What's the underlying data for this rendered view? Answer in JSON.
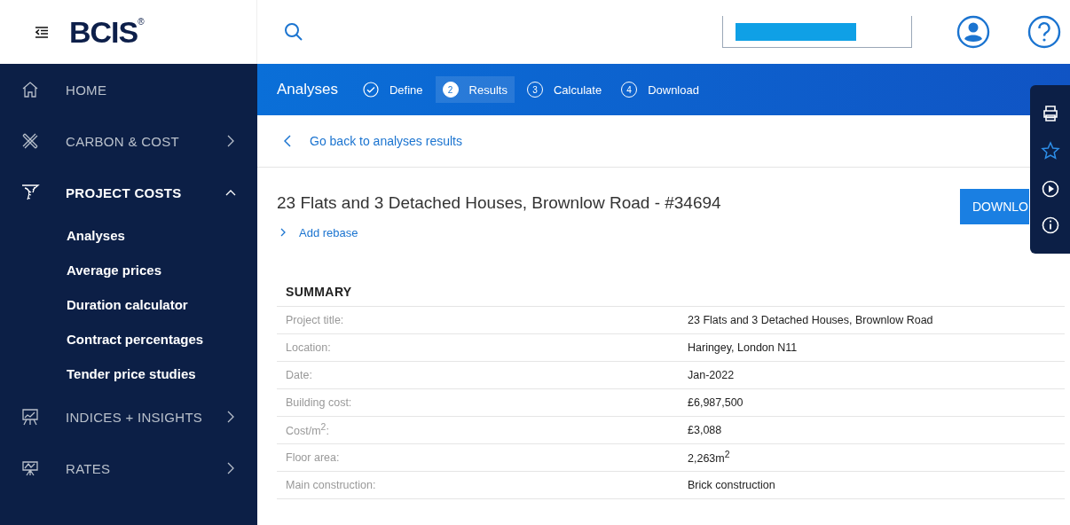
{
  "brand": {
    "logo": "BCIS",
    "mark": "®"
  },
  "header": {
    "search_field": {
      "filled": true
    }
  },
  "sidebar": {
    "items": [
      {
        "label": "HOME",
        "kind": "link",
        "expanded": false
      },
      {
        "label": "CARBON & COST",
        "kind": "group",
        "expanded": false
      },
      {
        "label": "PROJECT COSTS",
        "kind": "group",
        "expanded": true,
        "children": [
          {
            "label": "Analyses"
          },
          {
            "label": "Average prices"
          },
          {
            "label": "Duration calculator"
          },
          {
            "label": "Contract percentages"
          },
          {
            "label": "Tender price studies"
          }
        ]
      },
      {
        "label": "INDICES + INSIGHTS",
        "kind": "group",
        "expanded": false
      },
      {
        "label": "RATES",
        "kind": "group",
        "expanded": false
      }
    ]
  },
  "stepbar": {
    "title": "Analyses",
    "steps": [
      {
        "label": "Define",
        "done": true,
        "selected": false
      },
      {
        "number": "2",
        "label": "Results",
        "done": false,
        "selected": true
      },
      {
        "number": "3",
        "label": "Calculate",
        "done": false,
        "selected": false
      },
      {
        "number": "4",
        "label": "Download",
        "done": false,
        "selected": false
      }
    ]
  },
  "back_link": "Go back to analyses results",
  "project": {
    "title": "23 Flats and 3 Detached Houses, Brownlow Road - #34694",
    "download_button": "DOWNLO",
    "rebase_link": "Add rebase"
  },
  "summary": {
    "heading": "SUMMARY",
    "rows": [
      {
        "key": "Project title:",
        "value": "23 Flats and 3 Detached Houses, Brownlow Road"
      },
      {
        "key": "Location:",
        "value": "Haringey, London N11"
      },
      {
        "key": "Date:",
        "value": "Jan-2022"
      },
      {
        "key": "Building cost:",
        "value": "£6,987,500"
      },
      {
        "key": "Cost/m$^{2}$:",
        "value": "£3,088"
      },
      {
        "key": "Floor area:",
        "value": "2,263m$^{2}$"
      },
      {
        "key": "Main construction:",
        "value": "Brick construction"
      }
    ]
  }
}
